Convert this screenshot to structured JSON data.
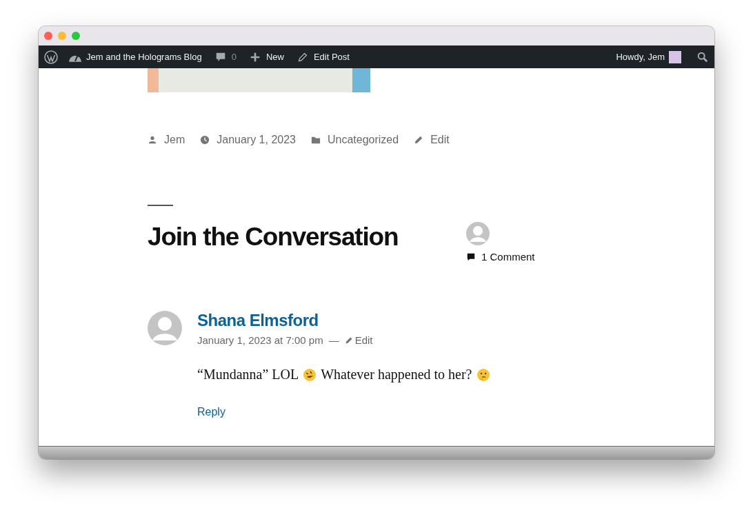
{
  "admin_bar": {
    "site": "Jem and the Holograms Blog",
    "comments": "0",
    "new": "New",
    "edit_post": "Edit Post",
    "greeting": "Howdy, Jem"
  },
  "post_meta": {
    "author": "Jem",
    "date": "January 1, 2023",
    "category": "Uncategorized",
    "edit": "Edit"
  },
  "comments_section": {
    "title": "Join the Conversation",
    "count": "1 Comment"
  },
  "comments": [
    {
      "author": "Shana Elmsford",
      "date": "January 1, 2023 at 7:00 pm",
      "separator": "—",
      "edit": "Edit",
      "body": [
        {
          "kind": "text",
          "text": "“Mundanna” LOL"
        },
        {
          "kind": "emoji-laugh"
        },
        {
          "kind": "text",
          "text": "Whatever happened to her?"
        },
        {
          "kind": "emoji-think"
        }
      ],
      "reply": "Reply"
    }
  ]
}
